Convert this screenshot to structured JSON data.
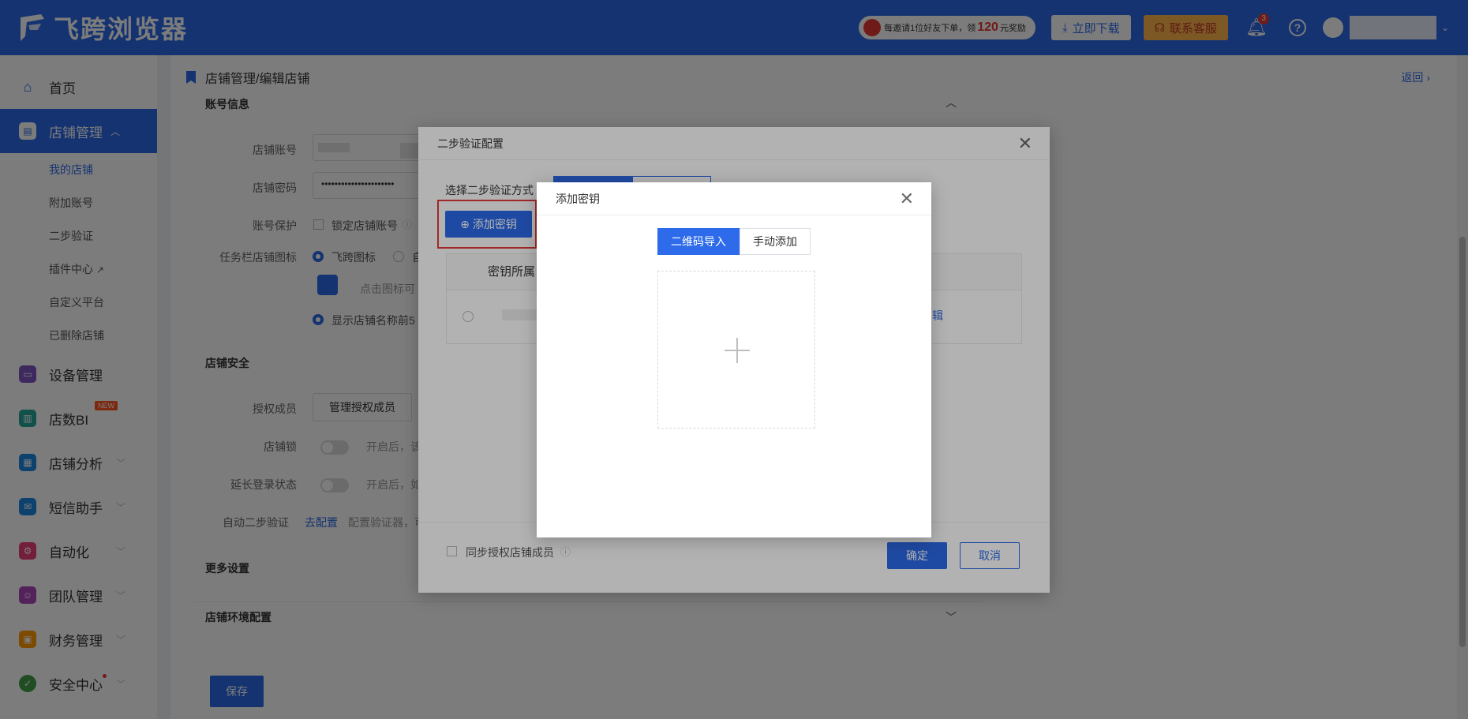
{
  "app": {
    "name": "飞跨浏览器"
  },
  "topbar": {
    "promo_prefix": "每邀请1位好友下单，领",
    "promo_amount": "120",
    "promo_suffix": "元奖励",
    "download_label": "立即下载",
    "support_label": "联系客服",
    "notification_count": "3"
  },
  "sidebar": {
    "home": "首页",
    "store_mgmt": "店铺管理",
    "store_sub": [
      "我的店铺",
      "附加账号",
      "二步验证",
      "插件中心",
      "自定义平台",
      "已删除店铺"
    ],
    "device_mgmt": "设备管理",
    "store_bi": "店数BI",
    "new_tag": "NEW",
    "store_analysis": "店铺分析",
    "sms_assistant": "短信助手",
    "automation": "自动化",
    "team_mgmt": "团队管理",
    "finance_mgmt": "财务管理",
    "security_center": "安全中心"
  },
  "main": {
    "breadcrumb": "店铺管理/编辑店铺",
    "back": "返回",
    "account_info": "账号信息",
    "store_account_label": "店铺账号",
    "store_password_label": "店铺密码",
    "password_mask": "••••••••••••••••••••••",
    "account_protect_label": "账号保护",
    "lock_account": "锁定店铺账号",
    "taskbar_icon_label": "任务栏店铺图标",
    "feikua_icon": "飞跨图标",
    "custom_prefix": "自",
    "click_icon_hint": "点击图标可",
    "show_name": "显示店铺名称前5",
    "store_security": "店铺安全",
    "authorized_members_label": "授权成员",
    "manage_members": "管理授权成员",
    "store_lock_label": "店铺锁",
    "store_lock_hint": "开启后，该",
    "extend_login_label": "延长登录状态",
    "extend_login_hint": "开启后，如",
    "auto_2fa_label": "自动二步验证",
    "go_configure": "去配置",
    "configure_hint": "配置验证器，可",
    "more_settings": "更多设置",
    "env_config": "店铺环境配置",
    "save": "保存"
  },
  "dialog_2fa": {
    "title": "二步验证配置",
    "select_method": "选择二步验证方式",
    "add_key": "添加密钥",
    "col_owner": "密钥所属",
    "edit_link": "辑",
    "sync_members": "同步授权店铺成员",
    "confirm": "确定",
    "cancel": "取消"
  },
  "dialog_add_key": {
    "title": "添加密钥",
    "tabs": [
      "二维码导入",
      "手动添加"
    ]
  },
  "colors": {
    "primary": "#2d6bea",
    "highlight_border": "#e53935"
  }
}
